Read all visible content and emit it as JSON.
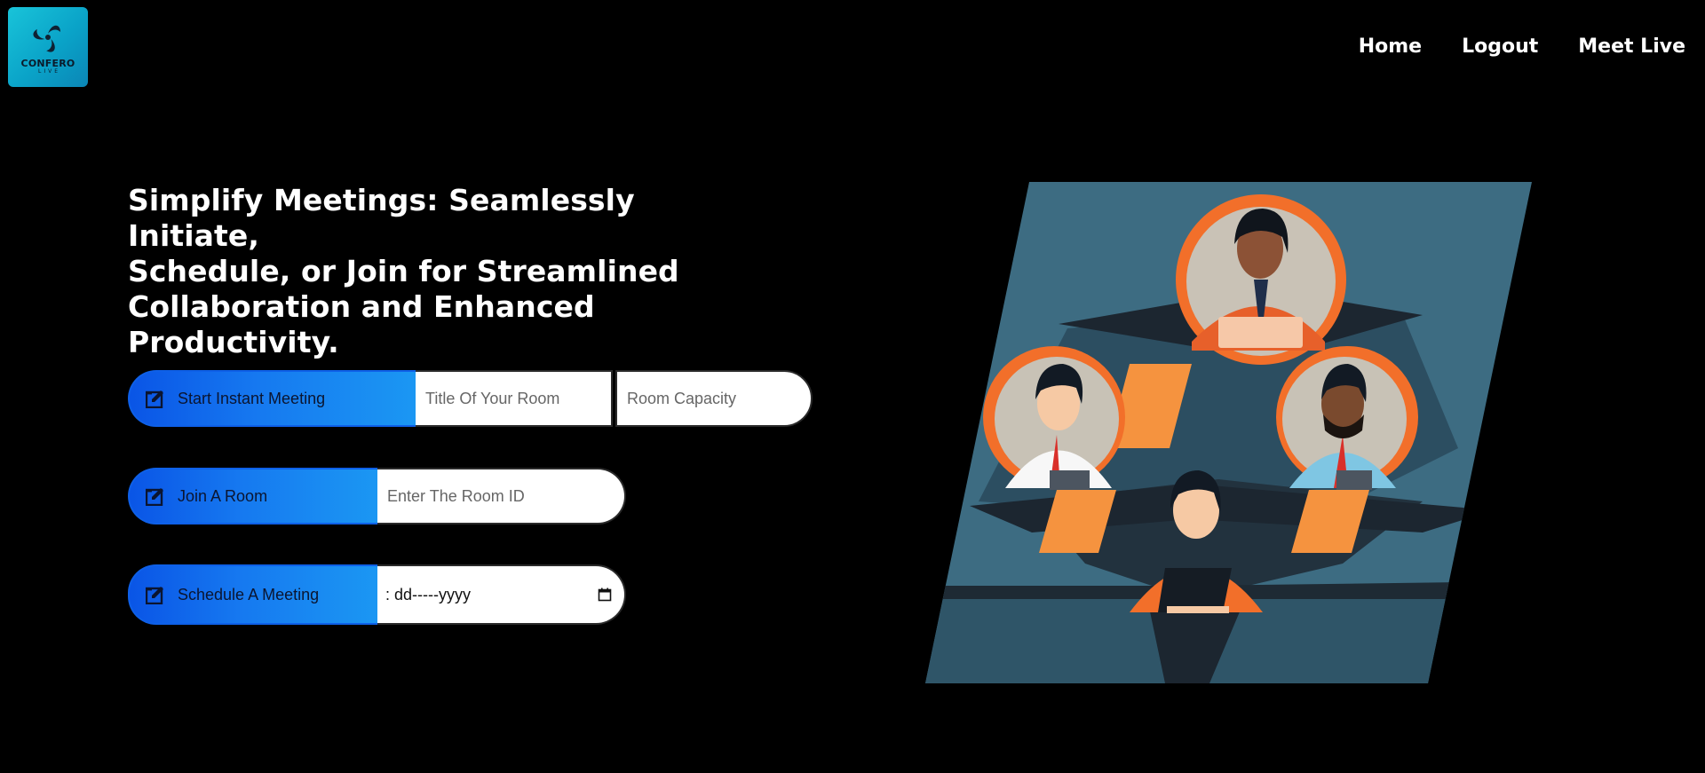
{
  "brand": {
    "logo_word": "CONFERO",
    "logo_sub": "LIVE",
    "accent": "#12b3d6"
  },
  "nav": {
    "items": [
      {
        "label": "Home"
      },
      {
        "label": "Logout"
      },
      {
        "label": "Meet Live"
      }
    ]
  },
  "hero": {
    "headline_lines": [
      "Simplify Meetings: Seamlessly Initiate,",
      "Schedule, or Join for Streamlined",
      "Collaboration and Enhanced Productivity."
    ]
  },
  "actions": {
    "instant": {
      "label": "Start Instant Meeting",
      "icon": "edit-icon",
      "title_placeholder": "Title Of Your Room",
      "capacity_placeholder": "Room Capacity"
    },
    "join": {
      "label": "Join A Room",
      "icon": "edit-icon",
      "room_placeholder": "Enter The Room ID"
    },
    "schedule": {
      "label": "Schedule A Meeting",
      "icon": "edit-icon",
      "date_value": ": dd-----yyyy",
      "date_icon": "calendar-icon"
    }
  },
  "colors": {
    "button_gradient_start": "#0a55e6",
    "button_gradient_end": "#1b97f3",
    "illustration_bg": "#3d6c82",
    "illustration_accent": "#f58a3c"
  }
}
